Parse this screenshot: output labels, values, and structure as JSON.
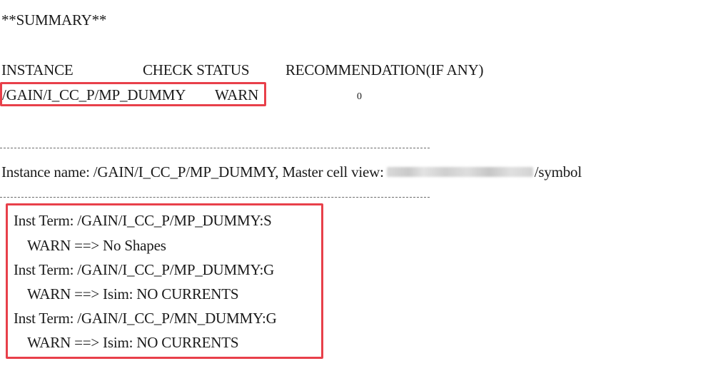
{
  "summary_heading": "**SUMMARY**",
  "table": {
    "headers": {
      "instance": "INSTANCE",
      "check_status": "CHECK STATUS",
      "recommendation": "RECOMMENDATION(IF ANY)"
    },
    "row": {
      "instance": "/GAIN/I_CC_P/MP_DUMMY",
      "status": "WARN",
      "recommendation": "0"
    }
  },
  "details": {
    "instance_label": "Instance name: /GAIN/I_CC_P/MP_DUMMY, Master cell view:",
    "cell_view_suffix": "/symbol",
    "lines": [
      "Inst Term: /GAIN/I_CC_P/MP_DUMMY:S",
      "WARN ==> No Shapes",
      "Inst Term: /GAIN/I_CC_P/MP_DUMMY:G",
      "WARN ==> Isim: NO CURRENTS",
      "Inst Term: /GAIN/I_CC_P/MN_DUMMY:G",
      "WARN ==> Isim: NO CURRENTS"
    ]
  },
  "colors": {
    "highlight_border": "#e8404a",
    "text": "#1a1a1a"
  }
}
